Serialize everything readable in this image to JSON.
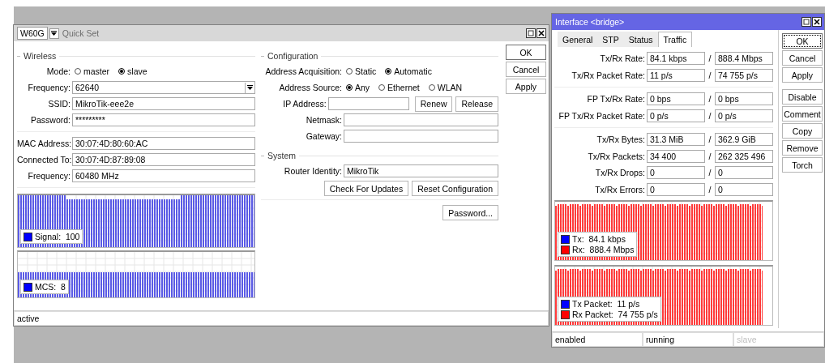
{
  "quick_set": {
    "interface": "W60G",
    "title": "Quick Set",
    "wireless": {
      "heading": "Wireless",
      "mode": {
        "label": "Mode:",
        "options": [
          {
            "label": "master",
            "selected": false
          },
          {
            "label": "slave",
            "selected": true
          }
        ]
      },
      "fields": [
        {
          "label": "Frequency:",
          "value": "62640",
          "kind": "dropdown"
        },
        {
          "label": "SSID:",
          "value": "MikroTik-eee2e",
          "kind": "text"
        },
        {
          "label": "Password:",
          "value": "*********",
          "kind": "text"
        }
      ],
      "status_fields": [
        {
          "label": "MAC Address:",
          "value": "30:07:4D:80:60:AC"
        },
        {
          "label": "Connected To:",
          "value": "30:07:4D:87:89:08"
        },
        {
          "label": "Frequency:",
          "value": "60480 MHz"
        }
      ]
    },
    "graphs": [
      {
        "kind": "signal",
        "legend": [
          {
            "label": "Signal:",
            "value": "100",
            "color": "#0000ff"
          }
        ]
      },
      {
        "kind": "mcs",
        "legend": [
          {
            "label": "MCS:",
            "value": "8",
            "color": "#0000ff"
          }
        ]
      }
    ],
    "configuration": {
      "heading": "Configuration",
      "radio_rows": [
        {
          "label": "Address Acquisition:",
          "options": [
            {
              "label": "Static",
              "selected": false
            },
            {
              "label": "Automatic",
              "selected": true
            }
          ]
        },
        {
          "label": "Address Source:",
          "options": [
            {
              "label": "Any",
              "selected": true
            },
            {
              "label": "Ethernet",
              "selected": false
            },
            {
              "label": "WLAN",
              "selected": false
            }
          ]
        }
      ],
      "fields": [
        {
          "label": "IP Address:",
          "buttons": [
            "Renew",
            "Release"
          ]
        },
        {
          "label": "Netmask:"
        },
        {
          "label": "Gateway:"
        }
      ]
    },
    "system": {
      "heading": "System",
      "fields": [
        {
          "label": "Router Identity:",
          "value": "MikroTik"
        }
      ],
      "buttons": [
        "Check For Updates",
        "Reset Configuration"
      ]
    },
    "password_button": "Password...",
    "side_buttons": [
      {
        "label": "OK",
        "default": true
      },
      {
        "label": "Cancel",
        "default": false
      },
      {
        "label": "Apply",
        "default": false
      }
    ],
    "status_bar": [
      "active"
    ]
  },
  "interface": {
    "title": "Interface <bridge>",
    "tabs": [
      {
        "label": "General",
        "selected": false
      },
      {
        "label": "STP",
        "selected": false
      },
      {
        "label": "Status",
        "selected": false
      },
      {
        "label": "Traffic",
        "selected": true
      }
    ],
    "groups": [
      [
        {
          "label": "Tx/Rx Rate:",
          "tx": "84.1 kbps",
          "sep": "/",
          "rx": "888.4 Mbps"
        },
        {
          "label": "Tx/Rx Packet Rate:",
          "tx": "11 p/s",
          "sep": "/",
          "rx": "74 755 p/s"
        }
      ],
      [
        {
          "label": "FP Tx/Rx Rate:",
          "tx": "0 bps",
          "sep": "/",
          "rx": "0 bps"
        },
        {
          "label": "FP Tx/Rx Packet Rate:",
          "tx": "0 p/s",
          "sep": "/",
          "rx": "0 p/s"
        }
      ],
      [
        {
          "label": "Tx/Rx Bytes:",
          "tx": "31.3 MiB",
          "sep": "/",
          "rx": "362.9 GiB"
        },
        {
          "label": "Tx/Rx Packets:",
          "tx": "34 400",
          "sep": "/",
          "rx": "262 325 496"
        },
        {
          "label": "Tx/Rx Drops:",
          "tx": "0",
          "sep": "/",
          "rx": "0"
        },
        {
          "label": "Tx/Rx Errors:",
          "tx": "0",
          "sep": "/",
          "rx": "0"
        }
      ]
    ],
    "graphs": [
      {
        "kind": "traffic",
        "legend": [
          {
            "label": "Tx:",
            "value": "84.1 kbps",
            "color": "#0000ff"
          },
          {
            "label": "Rx:",
            "value": "888.4 Mbps",
            "color": "#ff0000"
          }
        ]
      },
      {
        "kind": "traffic",
        "legend": [
          {
            "label": "Tx Packet:",
            "value": "11 p/s",
            "color": "#0000ff"
          },
          {
            "label": "Rx Packet:",
            "value": "74 755 p/s",
            "color": "#ff0000"
          }
        ]
      }
    ],
    "button_groups": [
      [
        {
          "label": "OK",
          "default": true
        },
        {
          "label": "Cancel",
          "default": false
        },
        {
          "label": "Apply",
          "default": false
        }
      ],
      [
        {
          "label": "Disable",
          "default": false
        },
        {
          "label": "Comment",
          "default": false
        },
        {
          "label": "Copy",
          "default": false
        },
        {
          "label": "Remove",
          "default": false
        },
        {
          "label": "Torch",
          "default": false
        }
      ]
    ],
    "status_bar": [
      {
        "text": "enabled",
        "disabled": false
      },
      {
        "text": "running",
        "disabled": false
      },
      {
        "text": "slave",
        "disabled": true
      }
    ]
  }
}
